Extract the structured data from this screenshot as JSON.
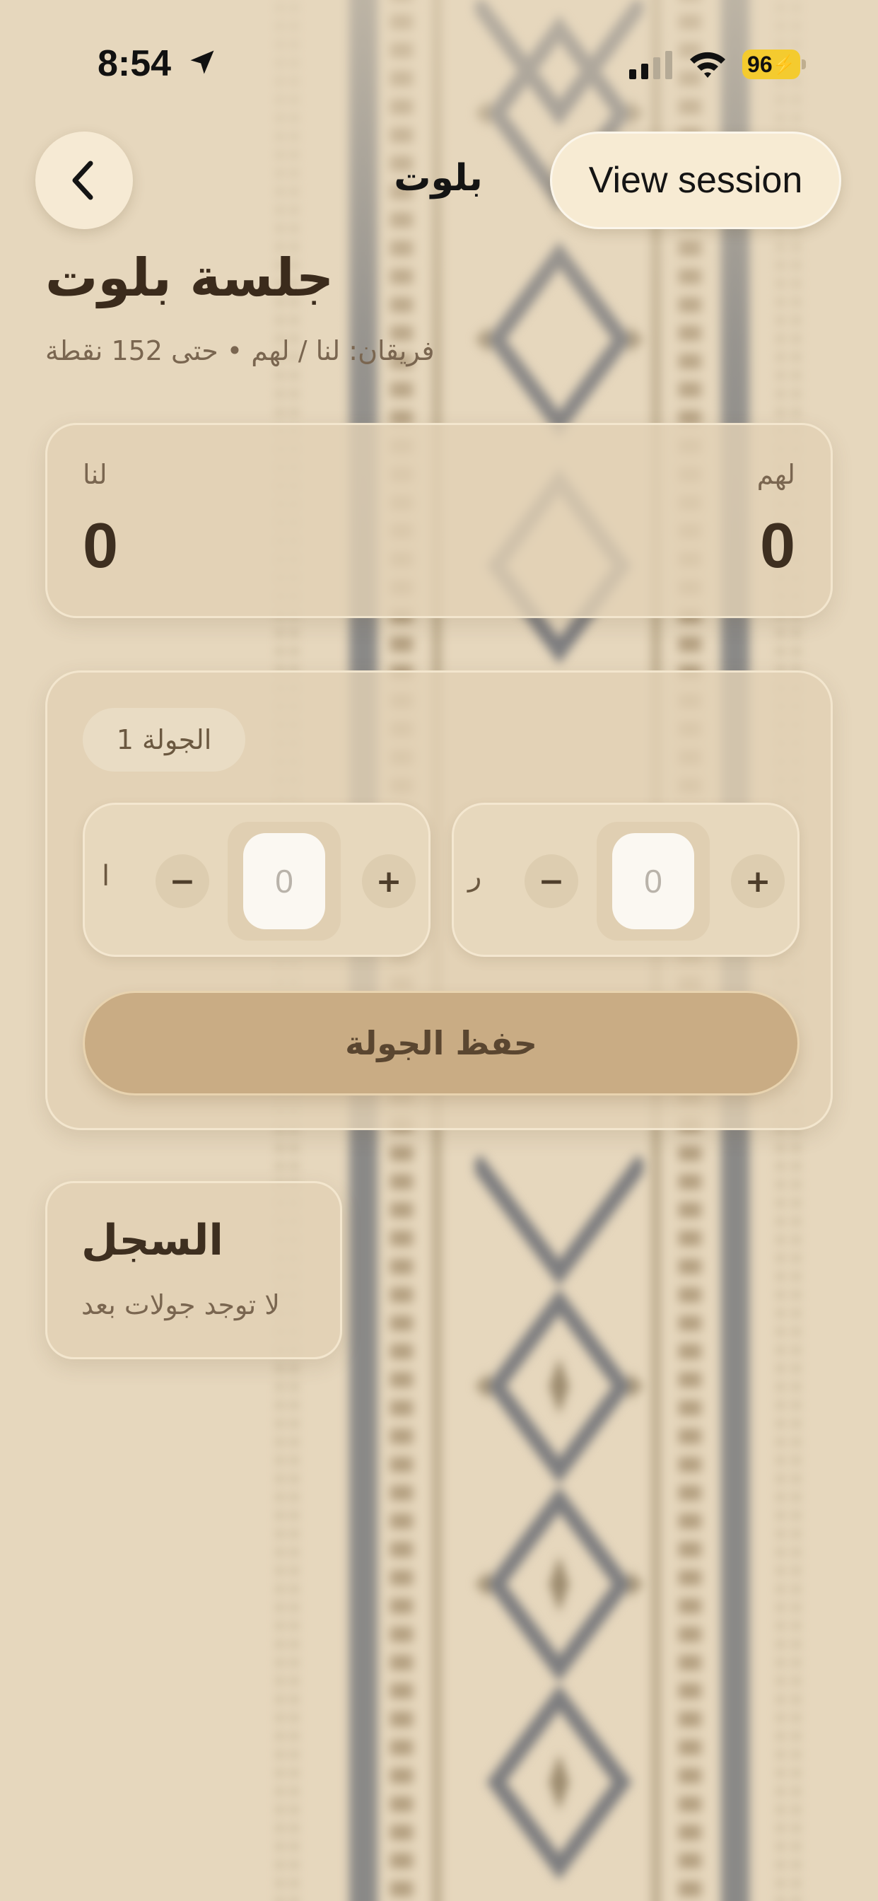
{
  "status_bar": {
    "time": "8:54",
    "battery": "96"
  },
  "nav": {
    "title": "بلوت",
    "view_session_label": "View session"
  },
  "header": {
    "title": "جلسة بلوت",
    "subtitle": "فريقان: لنا / لهم • حتى 152 نقطة"
  },
  "scoreboard": {
    "left_team": {
      "label": "لنا",
      "score": "0"
    },
    "right_team": {
      "label": "لهم",
      "score": "0"
    }
  },
  "round": {
    "label": "الجولة 1",
    "left_stepper": {
      "side_label": "ا",
      "minus": "−",
      "plus": "+",
      "value": "0"
    },
    "right_stepper": {
      "side_label": "ر",
      "minus": "−",
      "plus": "+",
      "value": "0"
    },
    "save_label": "حفظ الجولة"
  },
  "log": {
    "title": "السجل",
    "empty_text": "لا توجد جولات بعد"
  },
  "colors": {
    "background": "#e6d7bd",
    "card": "#e2d1b4",
    "save_button": "#c9ac84",
    "text_dark": "#3b2b1c",
    "battery": "#f4cb2f"
  }
}
